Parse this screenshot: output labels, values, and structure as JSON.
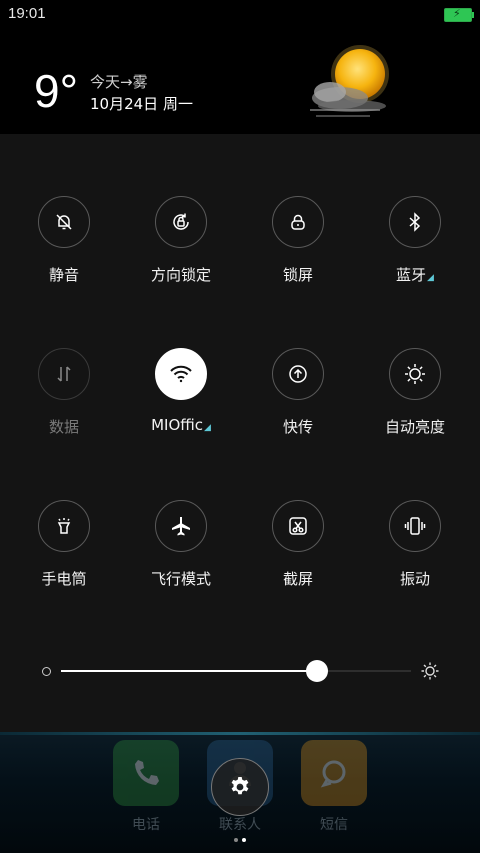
{
  "status_bar": {
    "time": "19:01"
  },
  "weather": {
    "temperature": "9°",
    "line1": "今天→雾",
    "line2": "10月24日 周一"
  },
  "toggles": [
    {
      "label": "静音",
      "icon": "bell-off-icon",
      "state": "off"
    },
    {
      "label": "方向锁定",
      "icon": "rotation-lock-icon",
      "state": "off"
    },
    {
      "label": "锁屏",
      "icon": "lock-icon",
      "state": "off"
    },
    {
      "label": "蓝牙",
      "icon": "bluetooth-icon",
      "state": "off",
      "has_menu": true
    },
    {
      "label": "数据",
      "icon": "mobile-data-icon",
      "state": "disabled"
    },
    {
      "label": "MIOffic",
      "icon": "wifi-icon",
      "state": "on",
      "has_menu": true
    },
    {
      "label": "快传",
      "icon": "quick-transfer-icon",
      "state": "off"
    },
    {
      "label": "自动亮度",
      "icon": "auto-brightness-icon",
      "state": "off"
    },
    {
      "label": "手电筒",
      "icon": "flashlight-icon",
      "state": "off"
    },
    {
      "label": "飞行模式",
      "icon": "airplane-icon",
      "state": "off"
    },
    {
      "label": "截屏",
      "icon": "screenshot-icon",
      "state": "off"
    },
    {
      "label": "振动",
      "icon": "vibrate-icon",
      "state": "off"
    }
  ],
  "brightness": {
    "level": 0.73
  },
  "dock": {
    "apps": [
      {
        "label": "电话",
        "icon": "phone-icon",
        "color": "#2e8b3a"
      },
      {
        "label": "联系人",
        "icon": "contacts-icon",
        "color": "#2a5d8a"
      },
      {
        "label": "短信",
        "icon": "message-icon",
        "color": "#d08a1a"
      }
    ]
  },
  "colors": {
    "accent": "#5ec8d6",
    "panel": "#141414",
    "battery": "#2ec654"
  }
}
